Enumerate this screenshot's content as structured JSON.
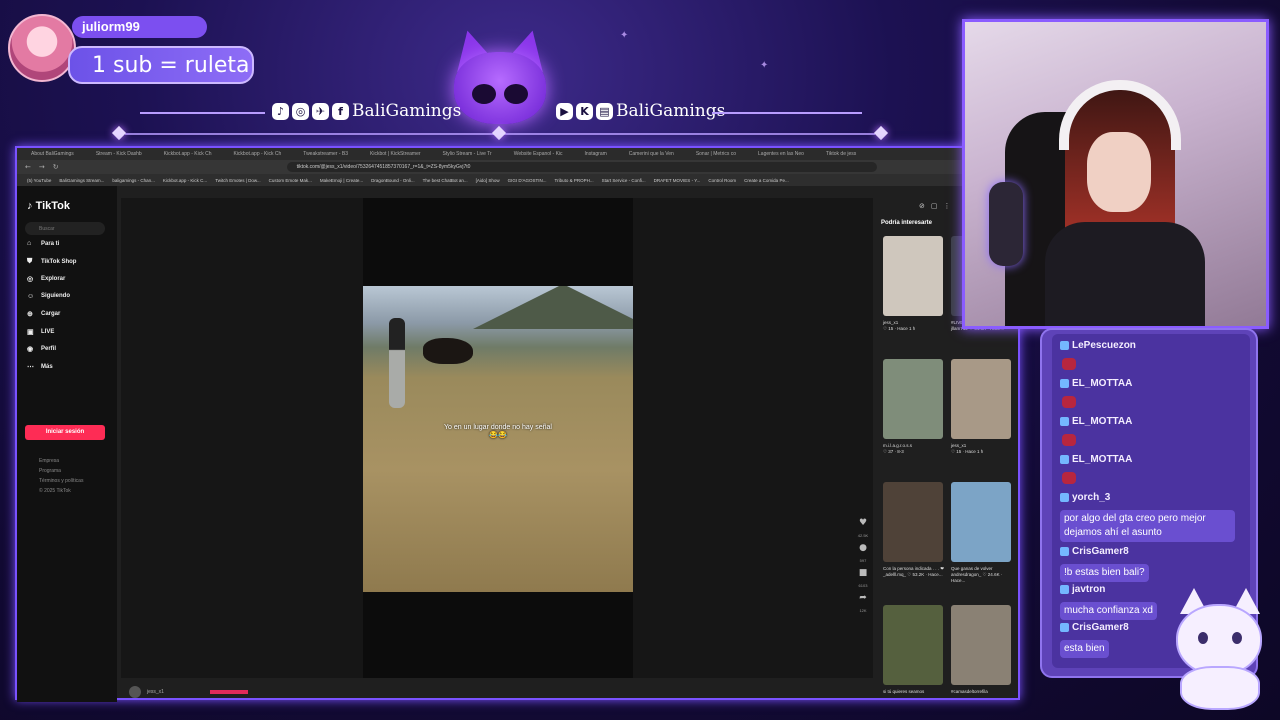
{
  "overlay": {
    "sub_username": "juliorm99",
    "sub_goal": "1 sub = ruleta",
    "social_left_handle": "BaliGamings",
    "social_right_handle": "BaliGamings"
  },
  "browser": {
    "tabs": [
      "About BaliGamings",
      "Stream - Kick Dashb",
      "Kickbot.app - Kick Ch",
      "Kickbot.app - Kick Ch",
      "Tweakstreamer - B3",
      "Kickbot | KickStreamer",
      "Stylio Stream - Live Tr",
      "Website Espanol - Kic",
      "Instagram",
      "Camerini que la Ven",
      "Sonar | Metrics co",
      "Lagentes en las Neo",
      "Tiktok de jess"
    ],
    "url": "tiktok.com/@jess_x1/video/7532647451857370167_r=1&_t=ZS-8ym5kyGvj7t0",
    "bookmarks": [
      "(5) YouTube",
      "BaliGamings Stream...",
      "baligamings - Chan...",
      "Kickbot.app - Kick C...",
      "Twitch Emotes | Dow...",
      "Custom Emote Mak...",
      "MakeEmoji | Create...",
      "DragonBound - Onli...",
      "The best ChatBot an...",
      "[Aido] Show",
      "GIGI D'AGOSTIN...",
      "Tributo & PROPH...",
      "Start Service - Confi...",
      "DRAFET MOVIES - Y...",
      "Control Room",
      "Create a Comida Pe..."
    ]
  },
  "tiktok": {
    "logo": "TikTok",
    "search_placeholder": "Buscar",
    "nav": [
      {
        "icon": "⌂",
        "label": "Para ti"
      },
      {
        "icon": "⛊",
        "label": "TikTok Shop"
      },
      {
        "icon": "◎",
        "label": "Explorar"
      },
      {
        "icon": "☺",
        "label": "Siguiendo"
      },
      {
        "icon": "⊕",
        "label": "Cargar"
      },
      {
        "icon": "▣",
        "label": "LIVE"
      },
      {
        "icon": "◉",
        "label": "Perfil"
      },
      {
        "icon": "⋯",
        "label": "Más"
      }
    ],
    "login_label": "Iniciar sesión",
    "footer": [
      "Empresa",
      "Programa",
      "Términos y políticas",
      "© 2025 TikTok"
    ],
    "video_caption": "Yo en un lugar donde no hay señal 😂😂",
    "actions": [
      {
        "icon": "♥",
        "count": "42.5K"
      },
      {
        "icon": "●",
        "count": "597"
      },
      {
        "icon": "■",
        "count": "6103"
      },
      {
        "icon": "➦",
        "count": "12K"
      }
    ],
    "bottom_username": "jess_x1",
    "right_title": "Podría interesarte",
    "suggestions": [
      {
        "caption": "jess_x1",
        "meta": "♡ 15 · Hace 1 h",
        "color": "#cfc7bd"
      },
      {
        "caption": "#LIVE",
        "meta": "jllam712 ♡ 44.6K · Hace...",
        "color": "#3b3f44"
      },
      {
        "caption": "m.i.l.a.g.r.o.s.s",
        "meta": "♡ 37 · 8-3",
        "color": "#7f8d7a"
      },
      {
        "caption": "jess_x1",
        "meta": "♡ 15 · Hace 1 h",
        "color": "#a89987"
      },
      {
        "caption": "Con la persona indicada . . . ❤",
        "meta": "_adelll.mq_ ♡ 53.2K · Hace...",
        "color": "#4f4238"
      },
      {
        "caption": "Que ganas de volver",
        "meta": "andresdragon_ ♡ 24.6K · Hace...",
        "color": "#7ca4c6"
      },
      {
        "caption": "si tú quieres seamos",
        "meta": "",
        "color": "#55603e"
      },
      {
        "caption": "#camasdeltorrefila",
        "meta": "",
        "color": "#8a8174"
      }
    ]
  },
  "chat": {
    "messages": [
      {
        "user": "LePescuezon",
        "text": ""
      },
      {
        "user": "EL_MOTTAA",
        "text": ""
      },
      {
        "user": "EL_MOTTAA",
        "text": ""
      },
      {
        "user": "EL_MOTTAA",
        "text": ""
      },
      {
        "user": "yorch_3",
        "text": "por algo del gta creo pero mejor dejamos ahí el asunto"
      },
      {
        "user": "CrisGamer8",
        "text": "!b estas bien bali?"
      },
      {
        "user": "javtron",
        "text": "mucha confianza xd"
      },
      {
        "user": "CrisGamer8",
        "text": "esta bien"
      }
    ]
  },
  "colors": {
    "accent": "#8a5cff",
    "tiktok_red": "#fe2c55",
    "chat_bg": "#5e43b8"
  }
}
